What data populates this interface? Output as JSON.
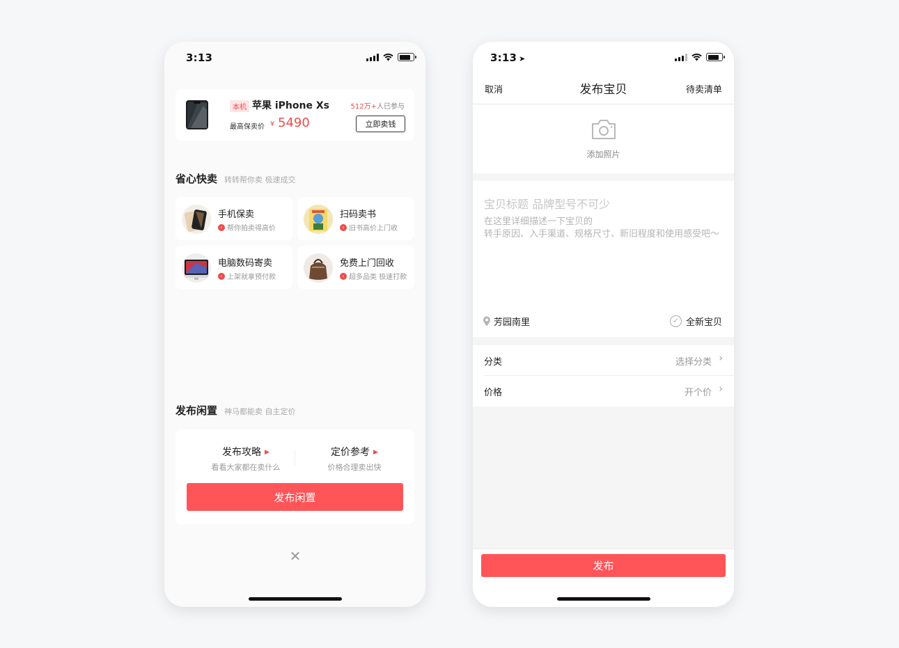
{
  "left": {
    "status": {
      "time": "3:13"
    },
    "promo": {
      "tag": "本机",
      "title": "苹果 iPhone Xs",
      "count_num": "512万+",
      "count_suffix": "人已参与",
      "price_label": "最高保卖价",
      "currency": "¥",
      "price": "5490",
      "button": "立即卖钱"
    },
    "quick_sell": {
      "title": "省心快卖",
      "subtitle": "转转帮你卖 极速成交",
      "items": [
        {
          "name": "手机保卖",
          "desc": "帮你拍卖得高价"
        },
        {
          "name": "扫码卖书",
          "desc": "旧书高价上门收"
        },
        {
          "name": "电脑数码寄卖",
          "desc": "上架就拿预付款"
        },
        {
          "name": "免费上门回收",
          "desc": "超多品类 极速打款"
        }
      ]
    },
    "publish": {
      "title": "发布闲置",
      "subtitle": "神马都能卖 自主定价",
      "guides": [
        {
          "title": "发布攻略",
          "sub": "看看大家都在卖什么"
        },
        {
          "title": "定价参考",
          "sub": "价格合理卖出快"
        }
      ],
      "button": "发布闲置"
    }
  },
  "right": {
    "status": {
      "time": "3:13"
    },
    "nav": {
      "cancel": "取消",
      "title": "发布宝贝",
      "right": "待卖清单"
    },
    "photo": {
      "label": "添加照片"
    },
    "form": {
      "title_placeholder": "宝贝标题 品牌型号不可少",
      "desc_placeholder": "在这里详细描述一下宝贝的\n转手原因、入手渠道、规格尺寸、新旧程度和使用感受吧～",
      "location": "芳园南里",
      "new_item": "全新宝贝"
    },
    "rows": [
      {
        "label": "分类",
        "value": "选择分类"
      },
      {
        "label": "价格",
        "value": "开个价"
      }
    ],
    "button": "发布"
  },
  "colors": {
    "accent": "#ff5558",
    "price_red": "#ef4b4b"
  }
}
